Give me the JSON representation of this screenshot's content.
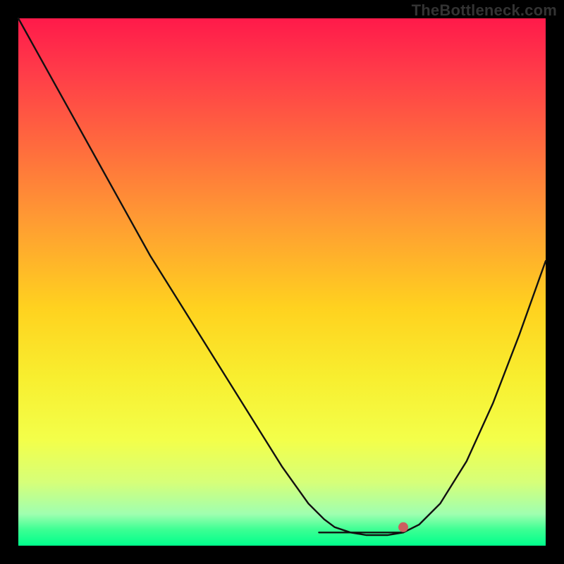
{
  "watermark": "TheBottleneck.com",
  "colors": {
    "frame_bg": "#000000",
    "curve_stroke": "#111111",
    "marker": "#cc5f5f",
    "gradient_top": "#ff1a4a",
    "gradient_bottom": "#00ff8c"
  },
  "chart_data": {
    "type": "line",
    "title": "",
    "xlabel": "",
    "ylabel": "",
    "xlim": [
      0,
      1
    ],
    "ylim": [
      0,
      1
    ],
    "x": [
      0.0,
      0.05,
      0.1,
      0.15,
      0.2,
      0.25,
      0.3,
      0.35,
      0.4,
      0.45,
      0.5,
      0.55,
      0.58,
      0.6,
      0.63,
      0.66,
      0.7,
      0.73,
      0.76,
      0.8,
      0.85,
      0.9,
      0.95,
      1.0
    ],
    "values": [
      1.0,
      0.91,
      0.82,
      0.73,
      0.64,
      0.55,
      0.47,
      0.39,
      0.31,
      0.23,
      0.15,
      0.08,
      0.05,
      0.035,
      0.025,
      0.02,
      0.02,
      0.025,
      0.04,
      0.08,
      0.16,
      0.27,
      0.4,
      0.54
    ],
    "marker": {
      "x_start": 0.57,
      "x_end": 0.73,
      "y": 0.025,
      "dot_x": 0.73,
      "dot_y": 0.035
    },
    "note": "x and y are normalized 0..1 within the gradient plot area; y=0 is the bottom (green), y=1 is the top (red)."
  }
}
